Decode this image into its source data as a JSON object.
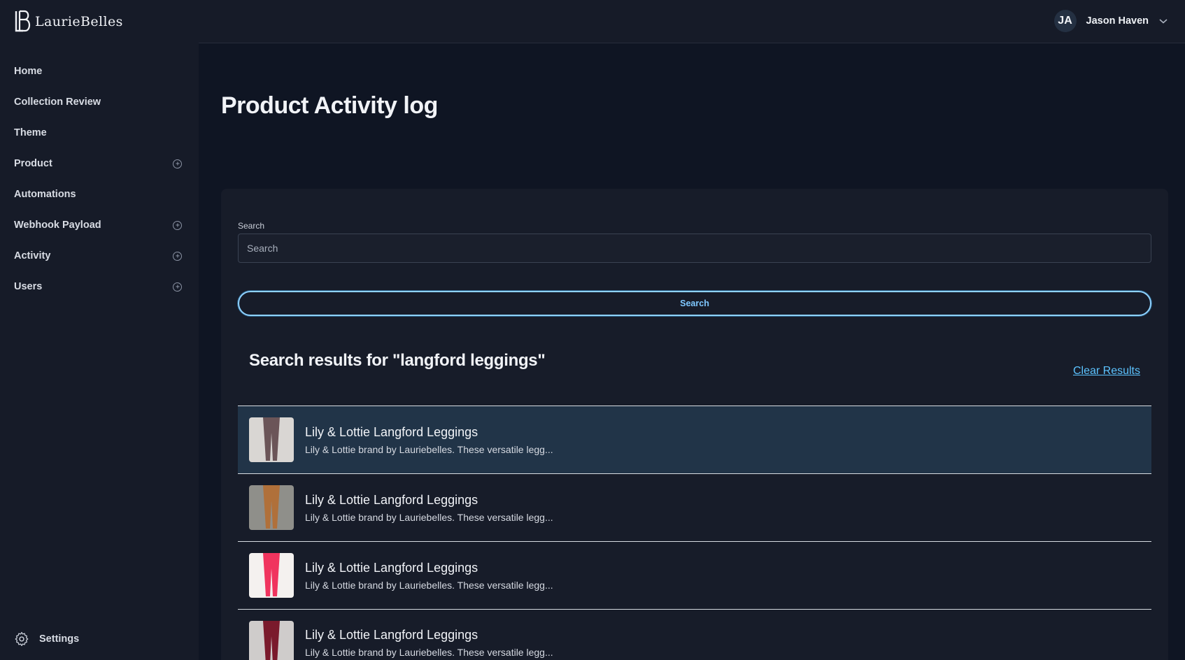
{
  "brand": {
    "name": "LaurieBelles"
  },
  "sidebar": {
    "items": [
      {
        "label": "Home",
        "expandable": false
      },
      {
        "label": "Collection Review",
        "expandable": false
      },
      {
        "label": "Theme",
        "expandable": false
      },
      {
        "label": "Product",
        "expandable": true
      },
      {
        "label": "Automations",
        "expandable": false
      },
      {
        "label": "Webhook Payload",
        "expandable": true
      },
      {
        "label": "Activity",
        "expandable": true
      },
      {
        "label": "Users",
        "expandable": true
      }
    ],
    "settings_label": "Settings"
  },
  "topbar": {
    "user_initials": "JA",
    "user_name": "Jason Haven"
  },
  "main": {
    "title": "Product Activity log",
    "search": {
      "label": "Search",
      "placeholder": "Search",
      "value": "",
      "button_label": "Search"
    },
    "results_title": "Search results for \"langford leggings\"",
    "clear_label": "Clear Results",
    "results": [
      {
        "title": "Lily & Lottie Langford Leggings",
        "description": "Lily & Lottie brand by Lauriebelles. These versatile legg...",
        "thumb_color": "#6b5558",
        "bg_color": "#d9d6d3",
        "selected": true
      },
      {
        "title": "Lily & Lottie Langford Leggings",
        "description": "Lily & Lottie brand by Lauriebelles. These versatile legg...",
        "thumb_color": "#b0703a",
        "bg_color": "#8f8f8a",
        "selected": false
      },
      {
        "title": "Lily & Lottie Langford Leggings",
        "description": "Lily & Lottie brand by Lauriebelles. These versatile legg...",
        "thumb_color": "#f0345e",
        "bg_color": "#f4f1ef",
        "selected": false
      },
      {
        "title": "Lily & Lottie Langford Leggings",
        "description": "Lily & Lottie brand by Lauriebelles. These versatile legg...",
        "thumb_color": "#7a1a2c",
        "bg_color": "#cfcccb",
        "selected": false
      }
    ]
  }
}
